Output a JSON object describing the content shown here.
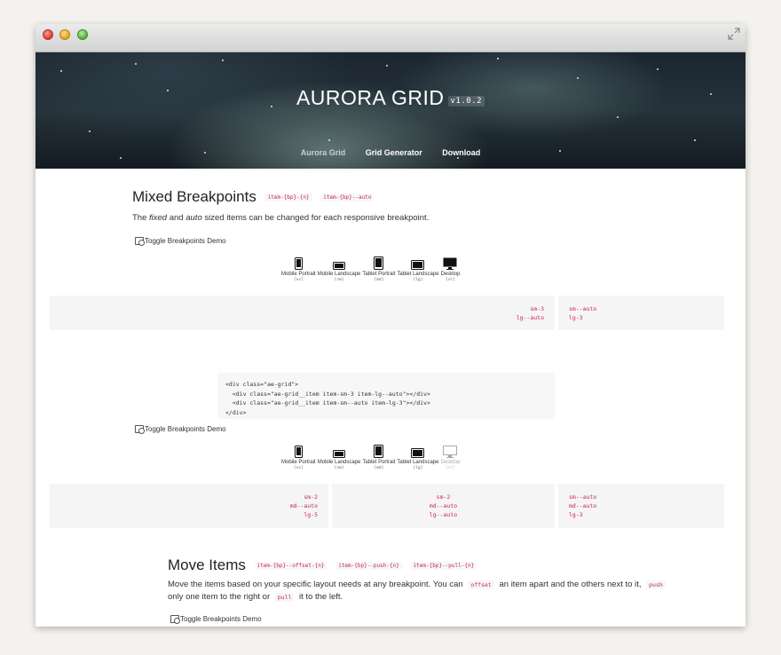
{
  "hero": {
    "title": "AURORA GRID",
    "version": "v1.0.2",
    "nav": [
      {
        "label": "Aurora Grid"
      },
      {
        "label": "Grid Generator"
      },
      {
        "label": "Download"
      }
    ]
  },
  "mixed": {
    "heading": "Mixed Breakpoints",
    "chips": [
      "item-{bp}-{n}",
      "item-{bp}--auto"
    ],
    "desc_pre": "The ",
    "desc_fixed": "fixed",
    "desc_mid": " and ",
    "desc_auto": "auto",
    "desc_post": " sized items can be changed for each responsive breakpoint.",
    "toggle_label": "Toggle Breakpoints Demo",
    "devices": [
      {
        "label": "Mobile Portrait",
        "bp": "[xs]"
      },
      {
        "label": "Mobile Landscape",
        "bp": "[sm]"
      },
      {
        "label": "Tablet Portrait",
        "bp": "[md]"
      },
      {
        "label": "Tablet Landscape",
        "bp": "[lg]"
      },
      {
        "label": "Desktop",
        "bp": "[xl]"
      }
    ],
    "demo1": [
      {
        "tags": [
          "sm-3",
          "lg--auto"
        ]
      },
      {
        "tags": [
          "sm--auto",
          "lg-3"
        ]
      }
    ],
    "code": [
      "<div class=\"ae-grid\">",
      "  <div class=\"ae-grid__item item-sm-3 item-lg--auto\"></div>",
      "  <div class=\"ae-grid__item item-sm--auto item-lg-3\"></div>",
      "</div>"
    ],
    "toggle_label_2": "Toggle Breakpoints Demo",
    "demo2": [
      {
        "tags": [
          "sm-2",
          "md--auto",
          "lg-5"
        ]
      },
      {
        "tags": [
          "sm-2",
          "md--auto",
          "lg--auto"
        ]
      },
      {
        "tags": [
          "sm--auto",
          "md--auto",
          "lg-3"
        ]
      }
    ]
  },
  "move": {
    "heading": "Move Items",
    "chips": [
      "item-{bp}--offset-{n}",
      "item-{bp}--push-{n}",
      "item-{bp}--pull-{n}"
    ],
    "desc_1": "Move the items based on your specific layout needs at any breakpoint. You can ",
    "chip_offset": "offset",
    "desc_2": " an item apart and the others next to it, ",
    "chip_push": "push",
    "desc_3": " only one item to the right or ",
    "chip_pull": "pull",
    "desc_4": " it to the left.",
    "toggle_label": "Toggle Breakpoints Demo"
  }
}
